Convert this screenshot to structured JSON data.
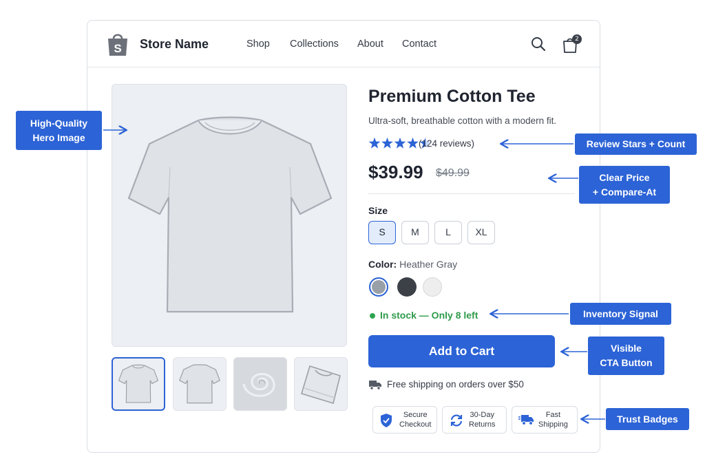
{
  "header": {
    "brand": "Store Name",
    "logo_letter": "S",
    "nav": [
      "Shop",
      "Collections",
      "About",
      "Contact"
    ],
    "cart_count": "2",
    "icons": [
      "search-icon",
      "shopping-bag-icon"
    ]
  },
  "product": {
    "title": "Premium Cotton Tee",
    "subtitle": "Ultra-soft, breathable cotton with a modern fit.",
    "rating": 4.5,
    "rating_max": 5,
    "review_count": "(124 reviews)",
    "price": "$39.99",
    "compare_at": "$49.99",
    "size_label": "Size",
    "sizes": [
      "S",
      "M",
      "L",
      "XL"
    ],
    "selected_size": "S",
    "color_label": "Color:",
    "color_value": "Heather Gray",
    "swatches": [
      "#9aa0a8",
      "#3c4047",
      "#eeeeee"
    ],
    "stock": "In stock — Only 8 left",
    "cta": "Add to Cart",
    "shipping": "Free shipping on orders over $50",
    "badges": [
      {
        "icon": "shield-icon",
        "line1": "Secure",
        "line2": "Checkout"
      },
      {
        "icon": "refresh-icon",
        "line1": "30-Day",
        "line2": "Returns"
      },
      {
        "icon": "truck-icon",
        "line1": "Fast",
        "line2": "Shipping"
      }
    ]
  },
  "callouts": {
    "hero": [
      "High-Quality",
      "Hero Image"
    ],
    "reviews": "Review Stars + Count",
    "price": [
      "Clear Price",
      "+ Compare-At"
    ],
    "inventory": "Inventory Signal",
    "cta": [
      "Visible",
      "CTA Button"
    ],
    "trust": "Trust Badges"
  },
  "colors": {
    "accent": "#2c63d6",
    "stock": "#2e9b4b",
    "text": "#1f2430"
  }
}
